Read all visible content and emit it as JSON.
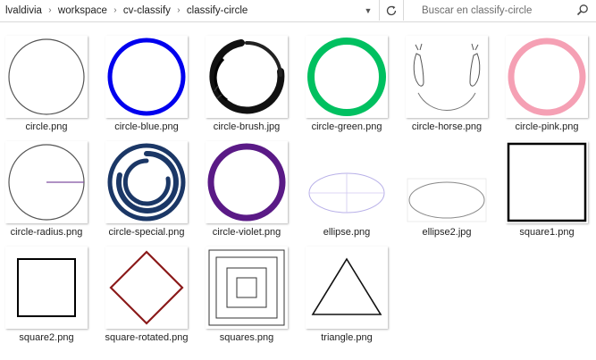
{
  "breadcrumb": {
    "items": [
      {
        "label": "lvaldivia"
      },
      {
        "label": "workspace"
      },
      {
        "label": "cv-classify"
      },
      {
        "label": "classify-circle"
      }
    ]
  },
  "search": {
    "placeholder": "Buscar en classify-circle"
  },
  "files": [
    {
      "name": "circle.png",
      "icon": "thin-circle"
    },
    {
      "name": "circle-blue.png",
      "icon": "blue-ring"
    },
    {
      "name": "circle-brush.jpg",
      "icon": "ink-brush-circle"
    },
    {
      "name": "circle-green.png",
      "icon": "green-ring"
    },
    {
      "name": "circle-horse.png",
      "icon": "horse-sketch-circle"
    },
    {
      "name": "circle-pink.png",
      "icon": "pink-ring"
    },
    {
      "name": "circle-radius.png",
      "icon": "circle-with-radius"
    },
    {
      "name": "circle-special.png",
      "icon": "double-navy-ring"
    },
    {
      "name": "circle-violet.png",
      "icon": "violet-ring"
    },
    {
      "name": "ellipse.png",
      "icon": "lavender-ellipse"
    },
    {
      "name": "ellipse2.jpg",
      "icon": "gray-ellipse"
    },
    {
      "name": "square1.png",
      "icon": "black-square"
    },
    {
      "name": "square2.png",
      "icon": "black-square"
    },
    {
      "name": "square-rotated.png",
      "icon": "red-diamond"
    },
    {
      "name": "squares.png",
      "icon": "nested-squares"
    },
    {
      "name": "triangle.png",
      "icon": "triangle"
    }
  ],
  "colors": {
    "blue": "#0000ee",
    "green": "#00c060",
    "pink": "#f5a0b4",
    "violet": "#5a1a86",
    "navy": "#1b3766",
    "purple_line": "#8050a0",
    "lavender": "#b8b0e8",
    "dark_red": "#8b1a1a"
  }
}
